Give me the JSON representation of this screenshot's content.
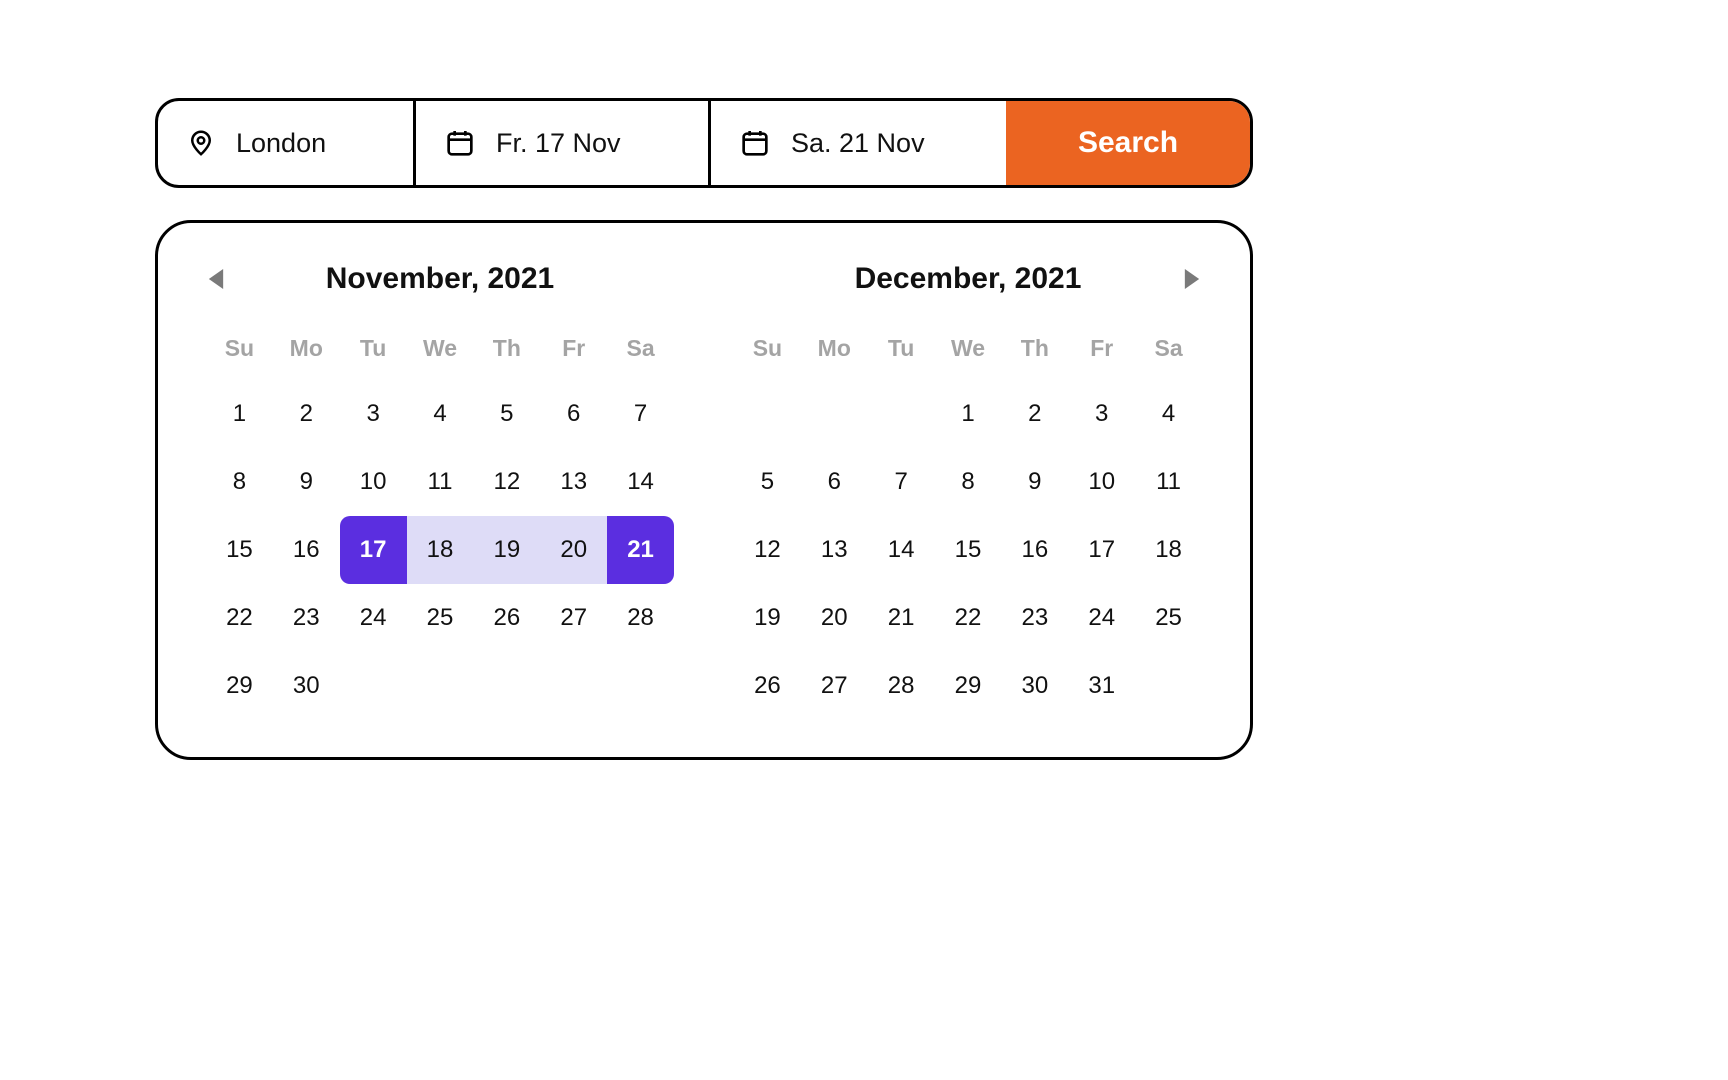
{
  "search": {
    "location": "London",
    "checkin": "Fr. 17 Nov",
    "checkout": "Sa. 21 Nov",
    "button_label": "Search"
  },
  "calendar": {
    "weekdays": [
      "Su",
      "Mo",
      "Tu",
      "We",
      "Th",
      "Fr",
      "Sa"
    ],
    "months": [
      {
        "title": "November, 2021",
        "first_blank": 0,
        "days": 30,
        "range_start": 17,
        "range_end": 21
      },
      {
        "title": "December, 2021",
        "first_blank": 3,
        "days": 31,
        "range_start": null,
        "range_end": null
      }
    ]
  }
}
